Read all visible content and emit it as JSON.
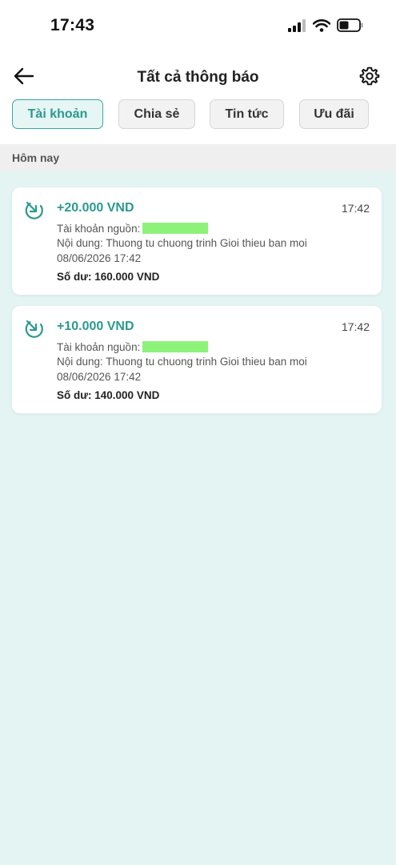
{
  "status_bar": {
    "time": "17:43"
  },
  "header": {
    "title": "Tất cả thông báo"
  },
  "tabs": [
    {
      "label": "Tài khoản",
      "active": true
    },
    {
      "label": "Chia sẻ",
      "active": false
    },
    {
      "label": "Tin tức",
      "active": false
    },
    {
      "label": "Ưu đãi",
      "active": false
    }
  ],
  "section": {
    "label": "Hôm nay"
  },
  "notifications": [
    {
      "amount": "+20.000 VND",
      "time": "17:42",
      "source_label": "Tài khoản nguồn:",
      "content": "Nội dung: Thuong tu chuong trinh Gioi thieu ban moi",
      "datetime": "08/06/2026 17:42",
      "balance": "Số dư: 160.000 VND"
    },
    {
      "amount": "+10.000 VND",
      "time": "17:42",
      "source_label": "Tài khoản nguồn:",
      "content": "Nội dung: Thuong tu chuong trinh Gioi thieu ban moi",
      "datetime": "08/06/2026 17:42",
      "balance": "Số dư: 140.000 VND"
    }
  ],
  "colors": {
    "accent": "#2a9a8f",
    "background": "#e4f4f3",
    "masked_highlight": "#8ef27a"
  },
  "icons": [
    "signal-icon",
    "wifi-icon",
    "battery-icon",
    "back-arrow-icon",
    "gear-icon",
    "incoming-arrow-icon"
  ]
}
